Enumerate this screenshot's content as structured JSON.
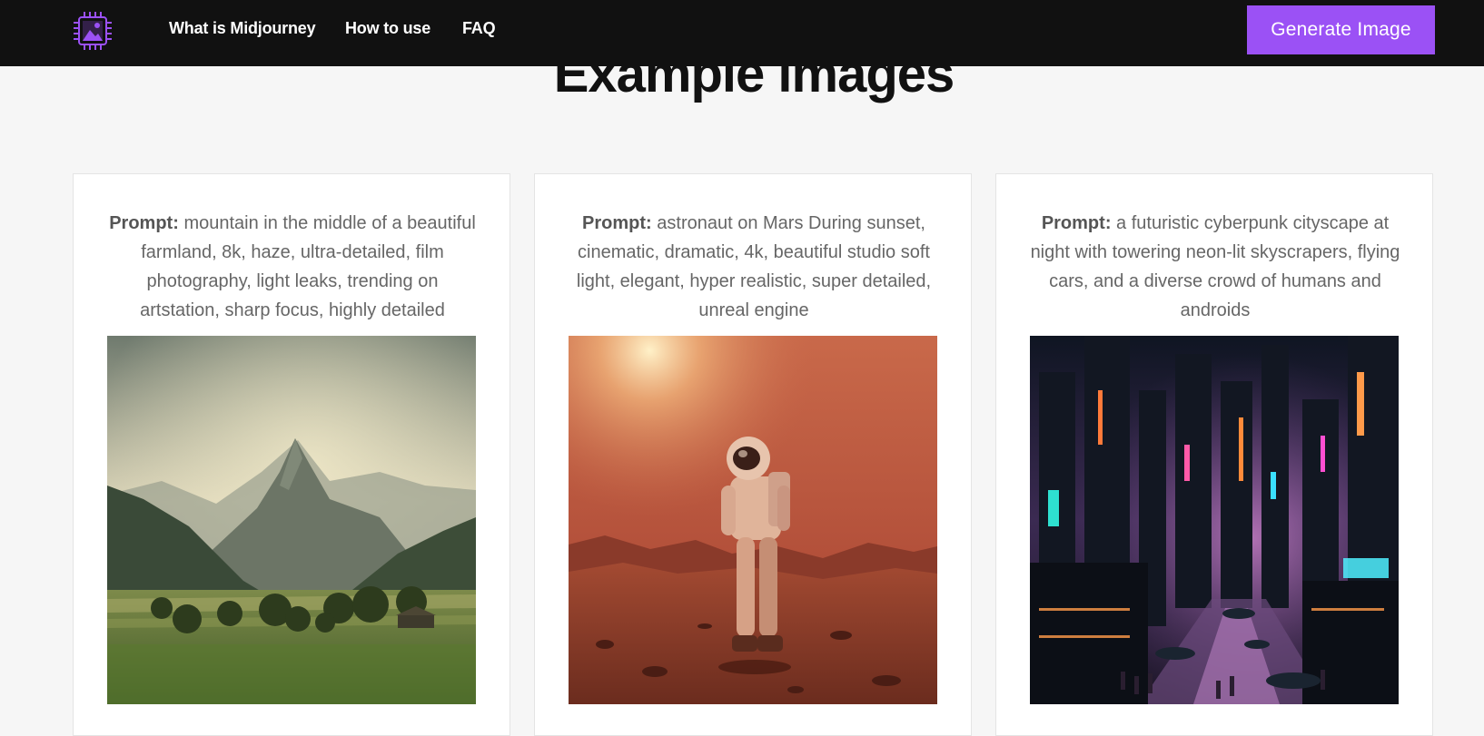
{
  "navbar": {
    "logo_icon": "chip-image-icon",
    "links": [
      "What is Midjourney",
      "How to use",
      "FAQ"
    ],
    "cta_label": "Generate Image",
    "accent_color": "#9b51f5"
  },
  "section": {
    "title": "Example images"
  },
  "cards": [
    {
      "prompt_label": "Prompt:",
      "prompt_text": " mountain in the middle of a beautiful farmland, 8k, haze, ultra-detailed, film photography, light leaks, trending on artstation, sharp focus, highly detailed",
      "image_subject": "mountain-farmland-image"
    },
    {
      "prompt_label": "Prompt:",
      "prompt_text": " astronaut on Mars During sunset, cinematic, dramatic, 4k, beautiful studio soft light, elegant, hyper realistic, super detailed, unreal engine",
      "image_subject": "astronaut-mars-image"
    },
    {
      "prompt_label": "Prompt:",
      "prompt_text": " a futuristic cyberpunk cityscape at night with towering neon-lit skyscrapers, flying cars, and a diverse crowd of humans and androids",
      "image_subject": "cyberpunk-city-image"
    }
  ]
}
